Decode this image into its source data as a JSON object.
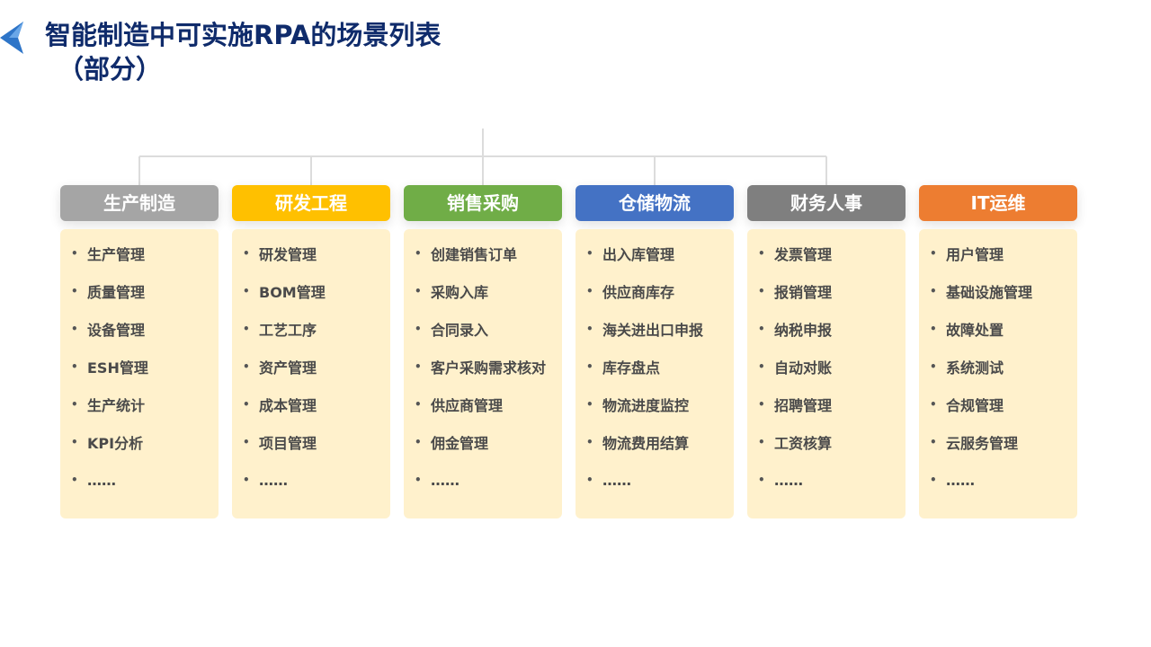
{
  "title": {
    "main": "智能制造中可实施RPA的场景列表",
    "sub": "（部分）"
  },
  "colors": {
    "title": "#0f2b6b",
    "connector": "#dcdcdc",
    "box_bg": "#fff1cc",
    "logo": "#2e75c8"
  },
  "columns": [
    {
      "label": "生产制造",
      "color": "#a5a5a5",
      "items": [
        "生产管理",
        "质量管理",
        "设备管理",
        "ESH管理",
        "生产统计",
        "KPI分析",
        "……"
      ]
    },
    {
      "label": "研发工程",
      "color": "#ffc000",
      "items": [
        "研发管理",
        "BOM管理",
        "工艺工序",
        "资产管理",
        "成本管理",
        "项目管理",
        "……"
      ]
    },
    {
      "label": "销售采购",
      "color": "#70ad47",
      "items": [
        "创建销售订单",
        "采购入库",
        "合同录入",
        "客户采购需求核对",
        "供应商管理",
        "佣金管理",
        "……"
      ]
    },
    {
      "label": "仓储物流",
      "color": "#4472c4",
      "items": [
        "出入库管理",
        "供应商库存",
        "海关进出口申报",
        "库存盘点",
        "物流进度监控",
        "物流费用结算",
        "……"
      ]
    },
    {
      "label": "财务人事",
      "color": "#7f7f7f",
      "items": [
        "发票管理",
        "报销管理",
        "纳税申报",
        "自动对账",
        "招聘管理",
        "工资核算",
        "……"
      ]
    },
    {
      "label": "IT运维",
      "color": "#ed7d31",
      "items": [
        "用户管理",
        "基础设施管理",
        "故障处置",
        "系统测试",
        "合规管理",
        "云服务管理",
        "……"
      ]
    }
  ]
}
